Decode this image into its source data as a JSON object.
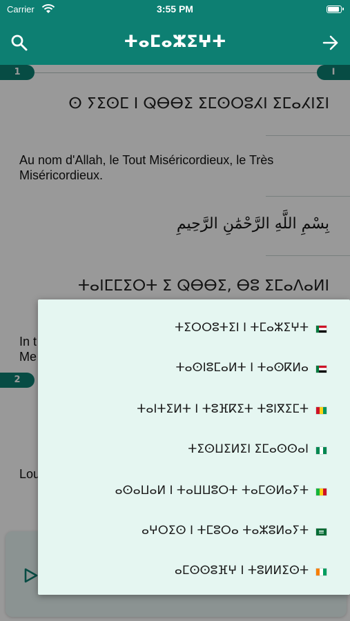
{
  "status": {
    "carrier": "Carrier",
    "time": "3:55 PM"
  },
  "nav": {
    "title": "ⵜⴰⵎⴰⵣⵉⵖⵜ"
  },
  "content": {
    "verse1_number": "1",
    "verse_right_badge": "ⵏ",
    "verse1_tifinagh": "ⵙ ⵢⵉⵙⵎ ⵏ ⵕⴱⴱⵉ ⵉⵎⵙⵔⵓⵃⵏ ⵉⵎⴰⵃⵏⵉⵏ",
    "verse1_french": "Au nom d'Allah, le Tout Miséricordieux, le Très Miséricordieux.",
    "verse1_arabic": "بِسْمِ اللَّهِ الرَّحْمَٰنِ الرَّحِيمِ",
    "verse2_tifinagh": "ⵜⴰⵏⵎⵎⵉⵔⵜ ⵉ ⵕⴱⴱⵉ, ⴱⵓ ⵉⵎⴰⴷⴰⵍⵏ",
    "partial_line1": "In t",
    "partial_line2": "Me",
    "verse2_number": "2",
    "partial_line3": "Lou"
  },
  "menu": {
    "items": [
      {
        "label": "ⵜⵉⵔⵔⵓⵜⵉⵏ ⵏ ⵜⵎⴰⵣⵉⵖⵜ",
        "flag": "ar"
      },
      {
        "label": "ⵜⴰⵙⵏⵓⵎⴰⵍⵜ ⵏ ⵜⴰⵙⴽⵍⴰ",
        "flag": "ar"
      },
      {
        "label": "ⵜⴰⵏⵜⵉⵍⵜ ⵏ ⵜⵓⴼⴽⵉⵜ ⵜⵓⵏⴳⵉⵎⵜ",
        "flag": "gn"
      },
      {
        "label": "ⵜⵉⵙⵡⵉⵍⵉⵏ ⵉⵎⴰⵙⵙⴰⵏ",
        "flag": "ng"
      },
      {
        "label": "ⴰⵙⴰⵡⴰⵍ ⵏ ⵜⴰⵡⵡⵓⵔⵜ ⵜⴰⵎⵙⵍⴰⵢⵜ",
        "flag": "ml"
      },
      {
        "label": "ⴰⵖⵔⵉⵙ ⵏ ⵜⵎⵓⵔⴰ ⵜⴰⵣⵓⵍⴰⵢⵜ",
        "flag": "sa"
      },
      {
        "label": "ⴰⵎⵙⵙⵓⴼⵖ ⵏ ⵜⵓⵍⵍⵉⵙⵜ",
        "flag": "ci"
      }
    ]
  },
  "colors": {
    "brand": "#0d7f72",
    "menu_bg": "#e5f6f1",
    "audiobar_bg": "#e8f6f3"
  }
}
